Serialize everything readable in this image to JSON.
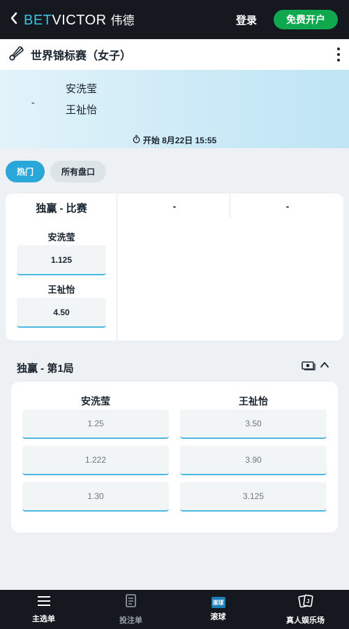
{
  "header": {
    "back_icon": "chevron-left-icon",
    "logo_bet": "BET",
    "logo_victor": "VICTOR",
    "logo_cn": "伟德",
    "login_label": "登录",
    "signup_label": "免费开户",
    "accent_color": "#3ec3e0",
    "signup_color": "#0fa84f"
  },
  "event": {
    "sport_icon": "badminton-shuttlecock-icon",
    "title": "世界锦标赛（女子）",
    "menu_icon": "more-vertical-icon"
  },
  "hero": {
    "score": "-",
    "player1": "安洗莹",
    "player2": "王祉怡",
    "start_icon": "stopwatch-icon",
    "start_text": "开始 8月22日 15:55"
  },
  "tabs": [
    {
      "label": "热门",
      "active": true
    },
    {
      "label": "所有盘口",
      "active": false
    }
  ],
  "match_winner": {
    "title": "独赢 - 比赛",
    "col2": "-",
    "col3": "-",
    "selections": [
      {
        "name": "安洗莹",
        "odds": "1.125"
      },
      {
        "name": "王祉怡",
        "odds": "4.50"
      }
    ]
  },
  "set1": {
    "title": "独赢 - 第1局",
    "cashout_icon": "cash-out-icon",
    "collapse_icon": "chevron-up-icon",
    "col1_header": "安洗莹",
    "col2_header": "王祉怡",
    "rows": [
      {
        "left": "1.25",
        "right": "3.50"
      },
      {
        "left": "1.222",
        "right": "3.90"
      },
      {
        "left": "1.30",
        "right": "3.125"
      }
    ]
  },
  "bottom_nav": [
    {
      "label": "主选单",
      "icon": "hamburger-menu-icon"
    },
    {
      "label": "投注单",
      "icon": "betslip-icon"
    },
    {
      "label": "滚球",
      "icon": "live-icon",
      "badge": "滚球"
    },
    {
      "label": "真人娱乐场",
      "icon": "playing-cards-icon"
    }
  ]
}
